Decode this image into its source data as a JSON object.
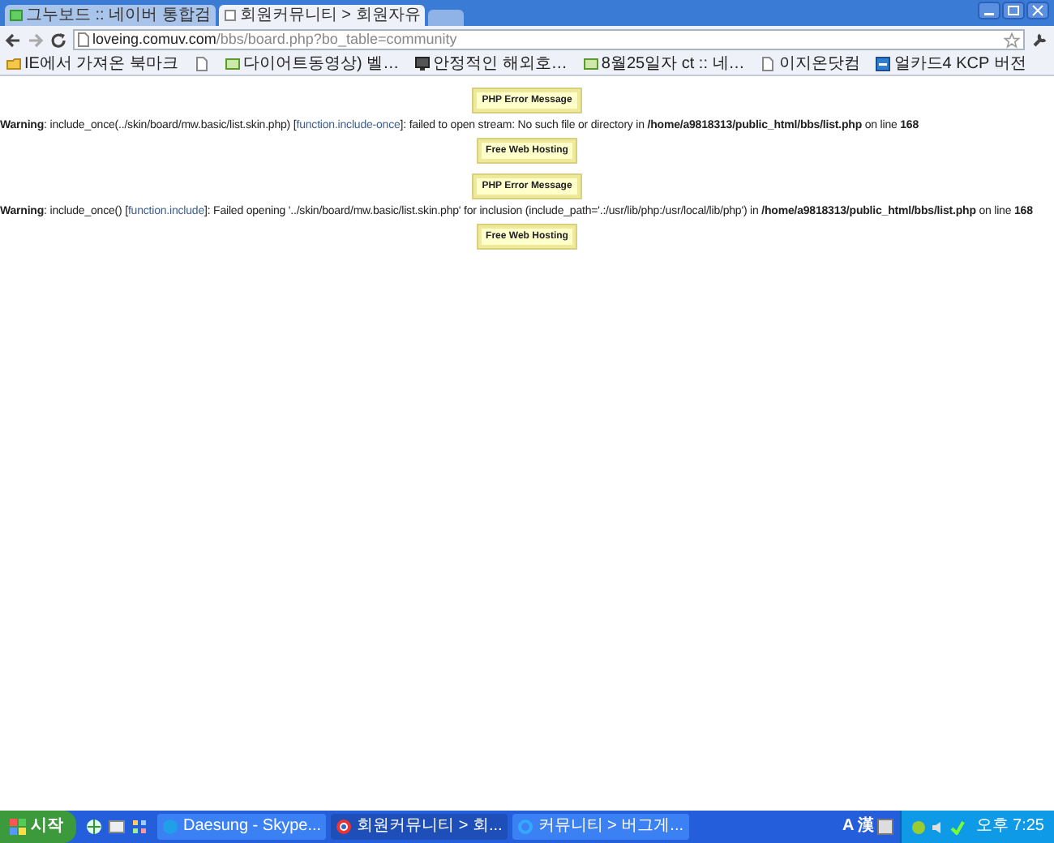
{
  "tabs": [
    {
      "label": "그누보드 :: 네이버 통합검",
      "selected": false
    },
    {
      "label": "회원커뮤니티 > 회원자유",
      "selected": true
    }
  ],
  "address": {
    "host": "loveing.comuv.com",
    "path": "/bbs/board.php?bo_table=community"
  },
  "bookmarks": [
    {
      "label": "IE에서 가져온 북마크",
      "kind": "folder"
    },
    {
      "kind": "page"
    },
    {
      "label": "다이어트동영상) 벨…",
      "kind": "site"
    },
    {
      "label": "안정적인 해외호…",
      "kind": "dark"
    },
    {
      "label": "8월25일자 ct :: 네…",
      "kind": "site"
    },
    {
      "label": "이지온닷컴",
      "kind": "page"
    },
    {
      "label": "얼카드4 KCP 버전",
      "kind": "blue"
    }
  ],
  "content": [
    {
      "kind": "badge",
      "label": "PHP Error Message"
    },
    {
      "kind": "warning",
      "before": "**Warning**: include_once(../skin/board/mw.basic/list.skin.php) [",
      "link": "function.include-once",
      "after": "]: failed to open stream: No such file or directory in **/home/a9818313/public_html/bbs/list.php** on line **168**"
    },
    {
      "kind": "badge",
      "label": "Free Web Hosting"
    },
    {
      "kind": "badge",
      "label": "PHP Error Message"
    },
    {
      "kind": "warning",
      "before": "**Warning**: include_once() [",
      "link": "function.include",
      "after": "]: Failed opening '../skin/board/mw.basic/list.skin.php' for inclusion (include_path='.:/usr/lib/php:/usr/local/lib/php') in **/home/a9818313/public_html/bbs/list.php** on line **168**"
    },
    {
      "kind": "badge",
      "label": "Free Web Hosting"
    }
  ],
  "taskbar": {
    "start": "시작",
    "tasks": [
      {
        "label": "Daesung - Skype...",
        "selected": false
      },
      {
        "label": "회원커뮤니티 > 회...",
        "selected": true
      },
      {
        "label": "커뮤니티 > 버그게...",
        "selected": false
      }
    ],
    "tray": [
      "A",
      "漢"
    ],
    "clock": "오후 7:25"
  }
}
